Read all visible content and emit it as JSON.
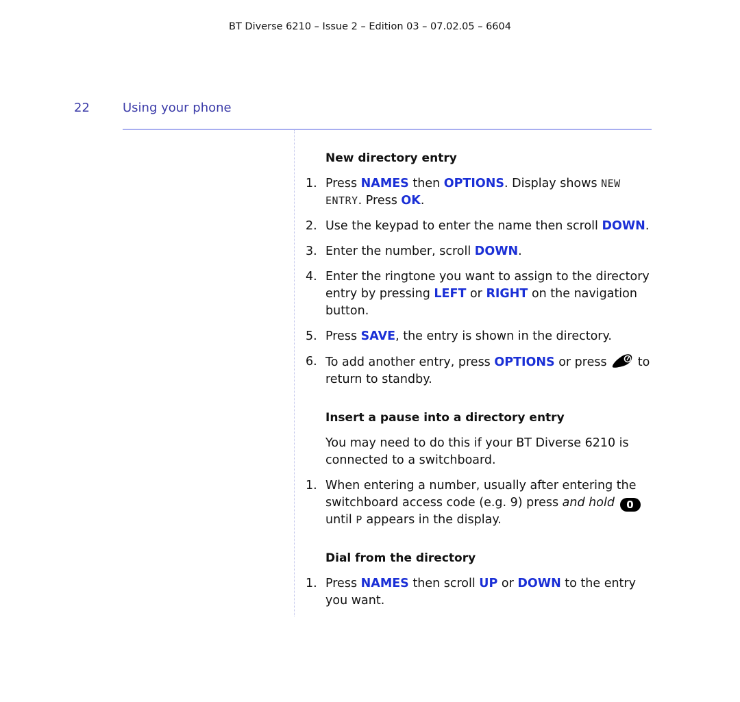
{
  "header": {
    "text": "BT Diverse 6210 – Issue 2 – Edition 03 – 07.02.05 – 6604"
  },
  "page": {
    "number": "22",
    "section_title": "Using your phone"
  },
  "colors": {
    "accent": "#3a3aa8",
    "key": "#1a2fd6",
    "rule": "#a8aef0"
  },
  "sections": {
    "new_entry": {
      "heading": "New directory entry",
      "steps": [
        {
          "num": "1.",
          "parts": [
            "Press ",
            "NAMES",
            " then ",
            "OPTIONS",
            ". Display shows ",
            "NEW ENTRY",
            ". Press ",
            "OK",
            "."
          ]
        },
        {
          "num": "2.",
          "parts": [
            "Use the keypad to enter the name then scroll ",
            "DOWN",
            "."
          ]
        },
        {
          "num": "3.",
          "parts": [
            "Enter the number, scroll ",
            "DOWN",
            "."
          ]
        },
        {
          "num": "4.",
          "parts": [
            "Enter the ringtone you want to assign to the directory entry by pressing ",
            "LEFT",
            " or ",
            "RIGHT",
            " on the navigation button."
          ]
        },
        {
          "num": "5.",
          "parts": [
            "Press ",
            "SAVE",
            ", the entry is shown in the directory."
          ]
        },
        {
          "num": "6.",
          "parts": [
            "To add another entry, press ",
            "OPTIONS",
            " or press ",
            "to return to standby."
          ],
          "icon": "end-call-icon"
        }
      ]
    },
    "pause": {
      "heading": "Insert a pause into a directory entry",
      "intro": "You may need to do this if your BT Diverse 6210 is connected to a switchboard.",
      "steps": [
        {
          "num": "1.",
          "parts": [
            "When entering a number, usually after entering the switchboard access code (e.g. 9) press ",
            "and hold",
            "0",
            "until",
            "P",
            " appears in the display."
          ],
          "icon": "zero-key-icon"
        }
      ]
    },
    "dial": {
      "heading": "Dial from the directory",
      "steps": [
        {
          "num": "1.",
          "parts": [
            "Press ",
            "NAMES",
            " then scroll ",
            "UP",
            " or ",
            "DOWN",
            " to the entry you want."
          ]
        }
      ]
    }
  }
}
